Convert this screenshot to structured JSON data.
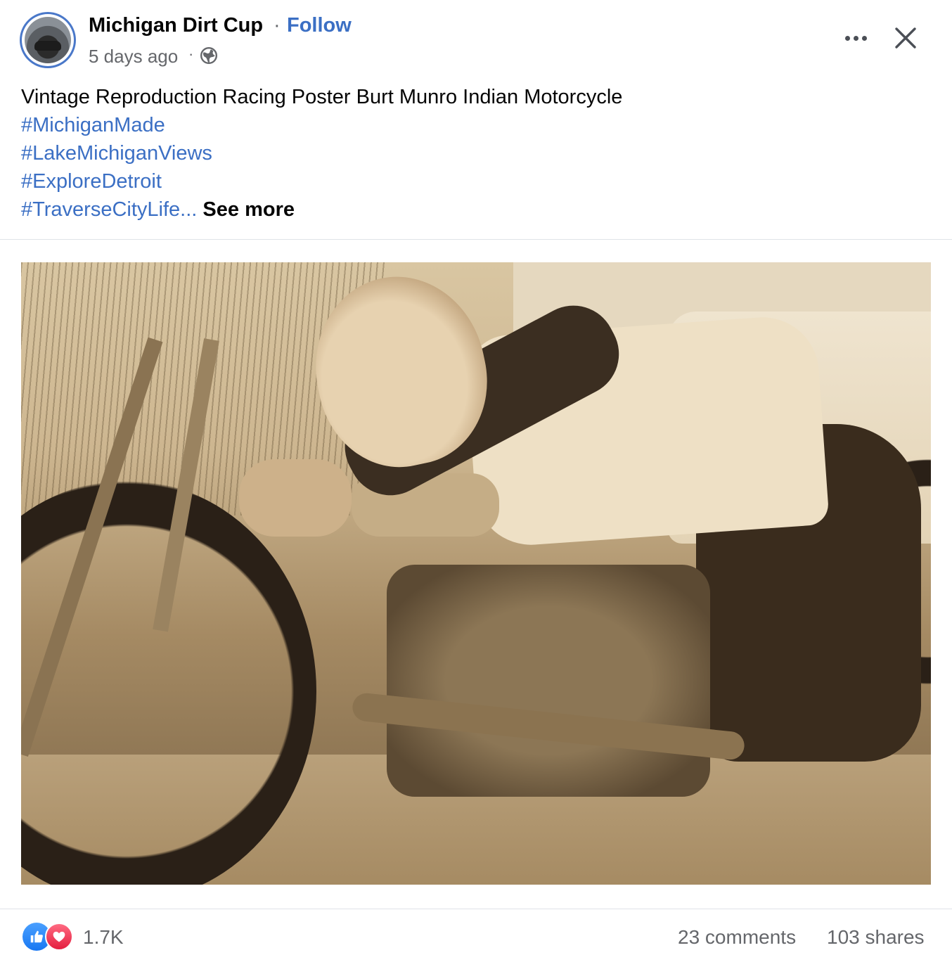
{
  "header": {
    "page_name": "Michigan Dirt Cup",
    "separator": "·",
    "follow_label": "Follow",
    "timestamp": "5 days ago",
    "timestamp_separator": "·",
    "audience_icon": "globe-icon",
    "more_icon": "more-options-icon",
    "close_icon": "close-icon"
  },
  "post": {
    "text": "Vintage Reproduction Racing Poster Burt Munro Indian Motorcycle",
    "hashtags": [
      "#MichiganMade",
      "#LakeMichiganViews",
      "#ExploreDetroit",
      "#TraverseCityLife"
    ],
    "ellipsis": "...",
    "see_more_label": "See more"
  },
  "footer": {
    "reaction_icons": [
      "like-icon",
      "love-icon"
    ],
    "reaction_count": "1.7K",
    "comments": "23 comments",
    "shares": "103 shares"
  },
  "colors": {
    "link_blue": "#3b6fc4",
    "secondary_text": "#65676b",
    "like_blue": "#1877f2",
    "love_red": "#e41e3f"
  }
}
